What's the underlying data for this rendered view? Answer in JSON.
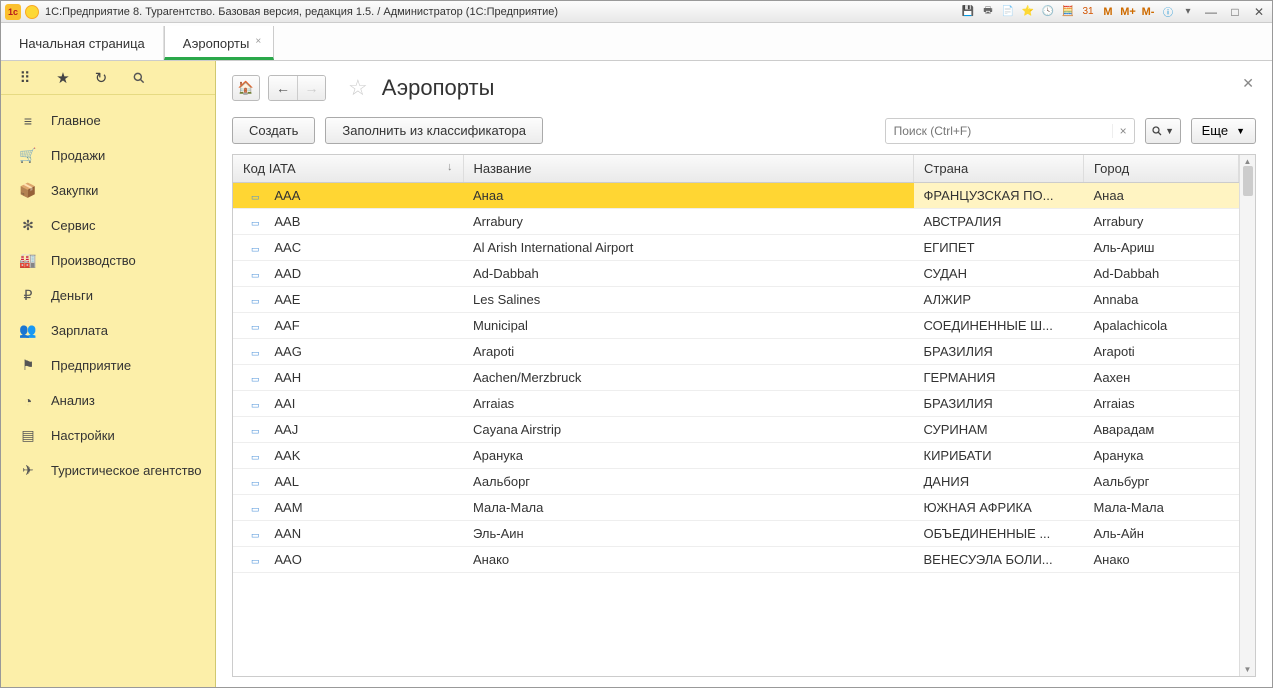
{
  "titlebar": {
    "title": "1С:Предприятие 8. Турагентство. Базовая версия, редакция 1.5. / Администратор  (1С:Предприятие)",
    "m1": "M",
    "m2": "M+",
    "m3": "M-"
  },
  "tabs": [
    {
      "label": "Начальная страница",
      "active": false,
      "closable": false
    },
    {
      "label": "Аэропорты",
      "active": true,
      "closable": true
    }
  ],
  "sidebar": {
    "items": [
      {
        "icon": "≡",
        "label": "Главное"
      },
      {
        "icon": "🛒",
        "label": "Продажи"
      },
      {
        "icon": "📦",
        "label": "Закупки"
      },
      {
        "icon": "✻",
        "label": "Сервис"
      },
      {
        "icon": "🏭",
        "label": "Производство"
      },
      {
        "icon": "₽",
        "label": "Деньги"
      },
      {
        "icon": "👥",
        "label": "Зарплата"
      },
      {
        "icon": "⚑",
        "label": "Предприятие"
      },
      {
        "icon": "◔",
        "label": "Анализ"
      },
      {
        "icon": "▤",
        "label": "Настройки"
      },
      {
        "icon": "✈",
        "label": "Туристическое агентство"
      }
    ]
  },
  "page": {
    "title": "Аэропорты",
    "create_btn": "Создать",
    "fill_btn": "Заполнить из классификатора",
    "search_placeholder": "Поиск (Ctrl+F)",
    "more_btn": "Еще"
  },
  "table": {
    "headers": {
      "iata": "Код IATA",
      "name": "Название",
      "country": "Страна",
      "city": "Город"
    },
    "rows": [
      {
        "iata": "AAA",
        "name": "Анаа",
        "country": "ФРАНЦУЗСКАЯ ПО...",
        "city": "Анаа",
        "selected": true
      },
      {
        "iata": "AAB",
        "name": "Arrabury",
        "country": "АВСТРАЛИЯ",
        "city": "Arrabury"
      },
      {
        "iata": "AAC",
        "name": "Al Arish International Airport",
        "country": "ЕГИПЕТ",
        "city": "Аль-Ариш"
      },
      {
        "iata": "AAD",
        "name": "Ad-Dabbah",
        "country": "СУДАН",
        "city": "Ad-Dabbah"
      },
      {
        "iata": "AAE",
        "name": "Les Salines",
        "country": "АЛЖИР",
        "city": "Annaba"
      },
      {
        "iata": "AAF",
        "name": "Municipal",
        "country": "СОЕДИНЕННЫЕ Ш...",
        "city": "Apalachicola"
      },
      {
        "iata": "AAG",
        "name": "Arapoti",
        "country": "БРАЗИЛИЯ",
        "city": "Arapoti"
      },
      {
        "iata": "AAH",
        "name": "Aachen/Merzbruck",
        "country": "ГЕРМАНИЯ",
        "city": "Аахен"
      },
      {
        "iata": "AAI",
        "name": "Arraias",
        "country": "БРАЗИЛИЯ",
        "city": "Arraias"
      },
      {
        "iata": "AAJ",
        "name": "Cayana Airstrip",
        "country": "СУРИНАМ",
        "city": "Аварадам"
      },
      {
        "iata": "AAK",
        "name": "Аранука",
        "country": "КИРИБАТИ",
        "city": "Аранука"
      },
      {
        "iata": "AAL",
        "name": "Аальборг",
        "country": "ДАНИЯ",
        "city": "Аальбург"
      },
      {
        "iata": "AAM",
        "name": "Мала-Мала",
        "country": "ЮЖНАЯ АФРИКА",
        "city": "Мала-Мала"
      },
      {
        "iata": "AAN",
        "name": "Эль-Аин",
        "country": "ОБЪЕДИНЕННЫЕ ...",
        "city": "Аль-Айн"
      },
      {
        "iata": "AAO",
        "name": "Анако",
        "country": "ВЕНЕСУЭЛА БОЛИ...",
        "city": "Анако"
      }
    ]
  }
}
